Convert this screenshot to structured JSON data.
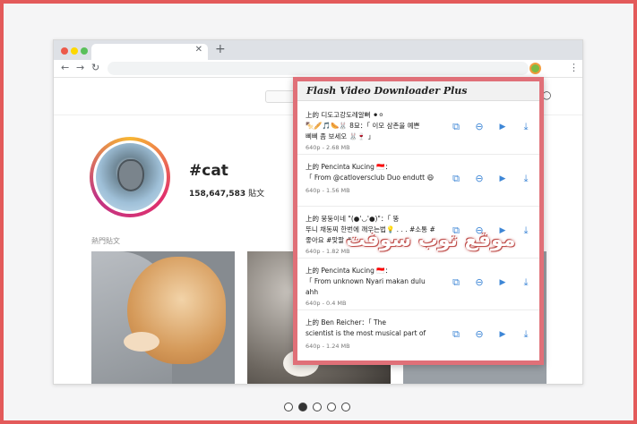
{
  "instagram": {
    "hashtag": "#cat",
    "post_count": "158,647,583",
    "post_count_suffix": "貼文",
    "top_posts_label": "熱門貼文"
  },
  "extension": {
    "title": "Flash Video Downloader Plus",
    "items": [
      {
        "text": "上的 디도고강도레알뻐 ⚫⚪\n🍢🥖🎵🌭🐰 8묘：「 이모 삼촌을 예쁜\n삐삐 좀 보세오 🐰🍷 」",
        "meta": "640p - 2.68 MB"
      },
      {
        "text": "上的 Pencinta Kucing 🇮🇩：\n「 From @catloversclub Duo endutt 😄",
        "meta": "640p - 1.56 MB"
      },
      {
        "text": "上的 뭉둥이네 \"(●'◡'●)\"：「 뚱\n뚜니 채동찌 한번에 깨우는법💡 . . . #소통 #\n좋아요 #맞팔 #",
        "meta": "640p - 1.82 MB"
      },
      {
        "text": "上的 Pencinta Kucing 🇮🇩：\n「 From unknown Nyari makan dulu\nahh",
        "meta": "640p - 0.4 MB"
      },
      {
        "text": "上的 Ben Reicher：「 The\nscientist is the most musical part of",
        "meta": "640p - 1.24 MB"
      }
    ],
    "actions": [
      "open-in-new-tab",
      "copy-link",
      "play",
      "download"
    ]
  },
  "watermark": "موقع توب سوفت",
  "pager": {
    "count": 5,
    "active_index": 1
  },
  "colors": {
    "frame": "#e35a5a",
    "popup_border": "#e07078",
    "action_blue": "#3d86d6"
  }
}
